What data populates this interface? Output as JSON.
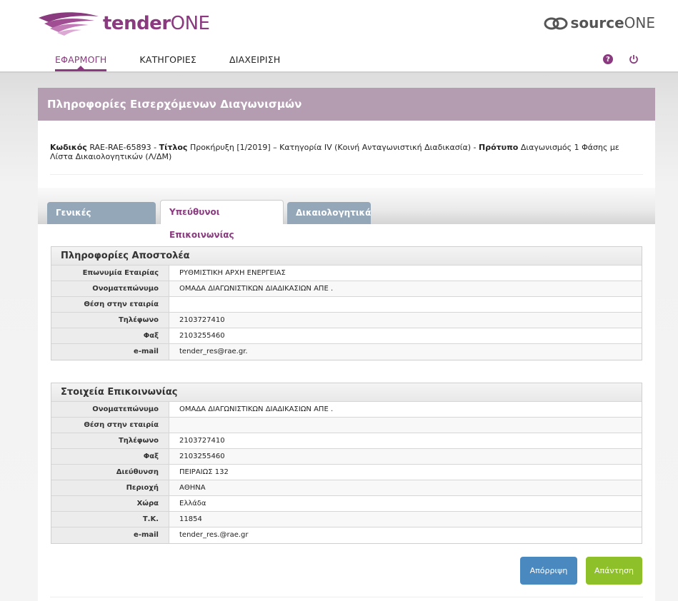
{
  "header": {
    "logo_brand_bold": "tender",
    "logo_brand_light": "ONE",
    "partner_brand_bold": "source",
    "partner_brand_light": "ONE"
  },
  "nav": {
    "items": [
      {
        "label": "ΕΦΑΡΜΟΓΗ",
        "active": true
      },
      {
        "label": "ΚΑΤΗΓΟΡΙΕΣ",
        "active": false
      },
      {
        "label": "ΔΙΑΧΕΙΡΙΣΗ",
        "active": false
      }
    ],
    "icons": [
      "help-icon",
      "power-icon"
    ]
  },
  "panel": {
    "title": "Πληροφορίες Εισερχόμενων Διαγωνισμών",
    "code_label": "Κωδικός",
    "code_value": "RAE-RAE-65893",
    "title_label": "Τίτλος",
    "title_value": "Προκήρυξη [1/2019] – Κατηγορία IV (Κοινή Ανταγωνιστική Διαδικασία)",
    "template_label": "Πρότυπο",
    "template_value": "Διαγωνισμός 1 Φάσης με Λίστα Δικαιολογητικών (Λ/ΔΜ)",
    "sep": "-"
  },
  "tabs": [
    {
      "label": "Γενικές Πληροφορίες",
      "active": false
    },
    {
      "label": "Υπεύθυνοι Επικοινωνίας",
      "active": true
    },
    {
      "label": "Δικαιολογητικά",
      "active": false
    }
  ],
  "sender": {
    "title": "Πληροφορίες Αποστολέα",
    "rows": [
      {
        "k": "Επωνυμία Εταιρίας",
        "v": "ΡΥΘΜΙΣΤΙΚΗ ΑΡΧΗ ΕΝΕΡΓΕΙΑΣ"
      },
      {
        "k": "Ονοματεπώνυμο",
        "v": "ΟΜΑΔΑ ΔΙΑΓΩΝΙΣΤΙΚΩΝ ΔΙΑΔΙΚΑΣΙΩΝ ΑΠΕ ."
      },
      {
        "k": "Θέση στην εταιρία",
        "v": ""
      },
      {
        "k": "Τηλέφωνο",
        "v": "2103727410"
      },
      {
        "k": "Φαξ",
        "v": "2103255460"
      },
      {
        "k": "e-mail",
        "v": "tender_res@rae.gr."
      }
    ]
  },
  "contact": {
    "title": "Στοιχεία Επικοινωνίας",
    "rows": [
      {
        "k": "Ονοματεπώνυμο",
        "v": "ΟΜΑΔΑ ΔΙΑΓΩΝΙΣΤΙΚΩΝ ΔΙΑΔΙΚΑΣΙΩΝ ΑΠΕ ."
      },
      {
        "k": "Θέση στην εταιρία",
        "v": ""
      },
      {
        "k": "Τηλέφωνο",
        "v": "2103727410"
      },
      {
        "k": "Φαξ",
        "v": "2103255460"
      },
      {
        "k": "Διεύθυνση",
        "v": "ΠΕΙΡΑΙΩΣ 132"
      },
      {
        "k": "Περιοχή",
        "v": "ΑΘΗΝΑ"
      },
      {
        "k": "Χώρα",
        "v": "Ελλάδα"
      },
      {
        "k": "Τ.Κ.",
        "v": "11854"
      },
      {
        "k": "e-mail",
        "v": "tender_res.@rae.gr"
      }
    ]
  },
  "actions": {
    "reject_label": "Απόρριψη",
    "answer_label": "Απάντηση"
  },
  "colors": {
    "brand": "#8a3a7f",
    "panel_header": "#b49cb1",
    "tab_inactive": "#93a7b8",
    "reject": "#4a88c0",
    "answer": "#8ec02a"
  }
}
